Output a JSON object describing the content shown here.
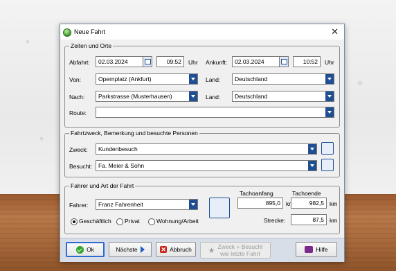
{
  "window": {
    "title": "Neue Fahrt",
    "close_glyph": "✕"
  },
  "zeiten": {
    "title": "Zeiten und Orte",
    "abfahrt_label": "Abfahrt:",
    "abfahrt_date": "02.03.2024",
    "abfahrt_time": "09:52",
    "uhr": "Uhr",
    "ankunft_label": "Ankunft:",
    "ankunft_date": "02.03.2024",
    "ankunft_time": "10:52",
    "von_label": "Von:",
    "von_value": "Opernplatz (Ankfurt)",
    "land_label": "Land:",
    "land1_value": "Deutschland",
    "nach_label": "Nach:",
    "nach_value": "Parkstrasse (Musterhausen)",
    "land2_value": "Deutschland",
    "route_label": "Route:",
    "route_value": ""
  },
  "zweck": {
    "title": "Fahrtzweck, Bemerkung und besuchte Personen",
    "zweck_label": "Zweck:",
    "zweck_value": "Kundenbesuch",
    "besucht_label": "Besucht:",
    "besucht_value": "Fa. Meier & Sohn"
  },
  "fahrer": {
    "title": "Fahrer und Art der Fahrt",
    "fahrer_label": "Fahrer:",
    "fahrer_value": "Franz Fahrenheit",
    "tacho_anfang_label": "Tachoanfang",
    "tacho_anfang_value": "895,0",
    "tacho_ende_label": "Tachoende",
    "tacho_ende_value": "982,5",
    "km": "km",
    "strecke_label": "Strecke:",
    "strecke_value": "87,5",
    "radio_geschaeftlich": "Geschäftlich",
    "radio_privat": "Privat",
    "radio_wohnung": "Wohnung/Arbeit",
    "selected": "Geschäftlich"
  },
  "buttons": {
    "ok": "Ok",
    "naechste": "Nächste",
    "abbruch": "Abbruch",
    "zweck_line1": "Zweck + Besucht",
    "zweck_line2": "wie letzte Fahrt",
    "hilfe": "Hilfe"
  },
  "icons": {
    "app": "app-icon",
    "calendar": "calendar-icon",
    "address_book": "address-book-icon",
    "save": "save-icon",
    "add_driver": "add-person-icon"
  }
}
